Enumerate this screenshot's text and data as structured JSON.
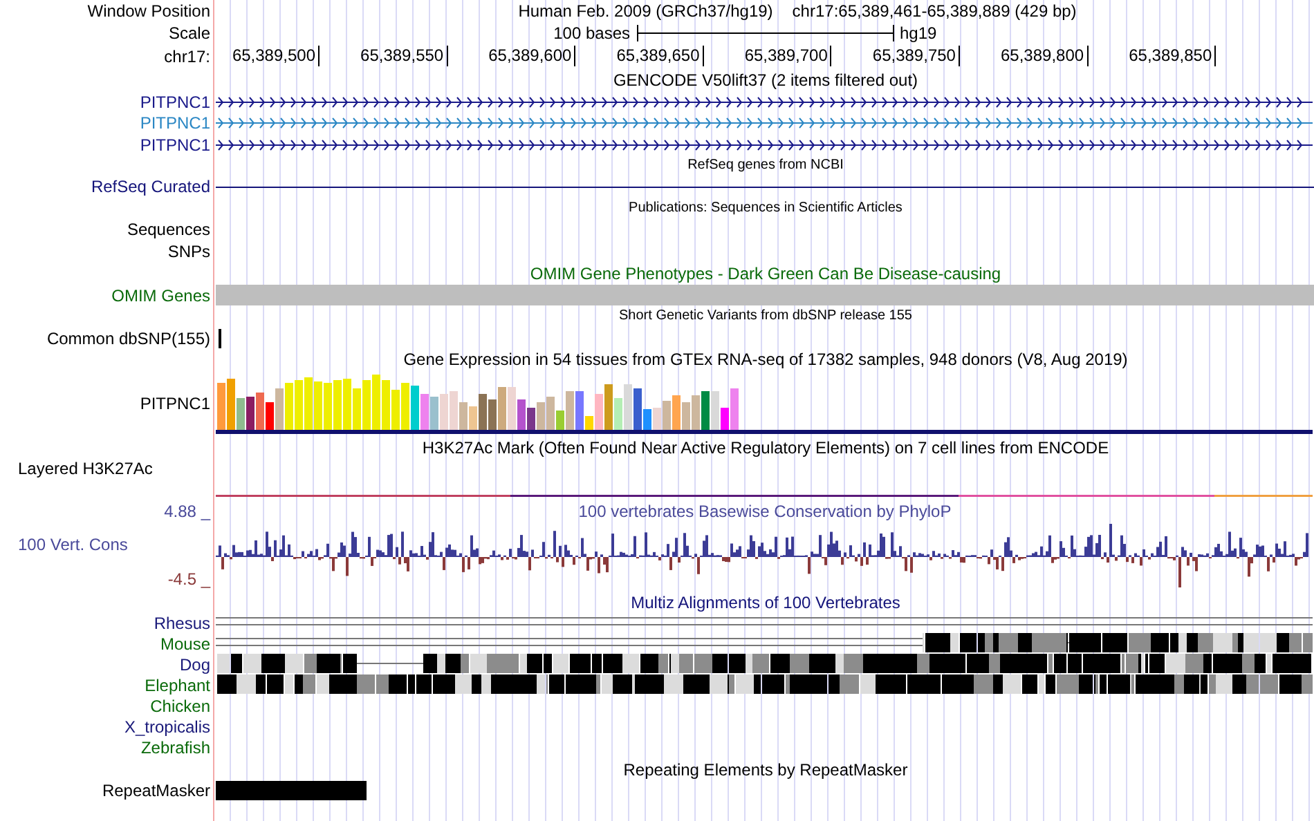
{
  "header": {
    "window_position_label": "Window Position",
    "assembly": "Human Feb. 2009 (GRCh37/hg19)",
    "position": "chr17:65,389,461-65,389,889 (429 bp)",
    "scale_label": "Scale",
    "scale_text": "100 bases",
    "scale_db": "hg19",
    "chrom_label": "chr17:",
    "ticks": [
      "65,389,500",
      "65,389,550",
      "65,389,600",
      "65,389,650",
      "65,389,700",
      "65,389,750",
      "65,389,800",
      "65,389,850"
    ]
  },
  "gencode": {
    "title": "GENCODE V50lift37 (2 items filtered out)",
    "transcripts": [
      {
        "label": "PITPNC1",
        "color": "#1a1a8a"
      },
      {
        "label": "PITPNC1",
        "color": "#2b87c4"
      },
      {
        "label": "PITPNC1",
        "color": "#1a1a8a"
      }
    ]
  },
  "refseq": {
    "title": "RefSeq genes from NCBI",
    "label": "RefSeq Curated"
  },
  "publications": {
    "title": "Publications: Sequences in Scientific Articles",
    "labels": [
      "Sequences",
      "SNPs"
    ]
  },
  "omim": {
    "title": "OMIM Gene Phenotypes - Dark Green Can Be Disease-causing",
    "label": "OMIM Genes"
  },
  "dbsnp": {
    "title": "Short Genetic Variants from dbSNP release 155",
    "label": "Common dbSNP(155)"
  },
  "gtex": {
    "title": "Gene Expression in 54 tissues from GTEx RNA-seq of 17382 samples, 948 donors (V8, Aug 2019)",
    "label": "PITPNC1"
  },
  "h3k27ac": {
    "title": "H3K27Ac Mark (Often Found Near Active Regulatory Elements) on 7 cell lines from ENCODE",
    "label": "Layered H3K27Ac"
  },
  "conservation": {
    "title": "100 vertebrates Basewise Conservation by PhyloP",
    "label": "100 Vert. Cons",
    "max_label": "4.88 _",
    "min_label": "-4.5 _"
  },
  "multiz": {
    "title": "Multiz Alignments of 100 Vertebrates",
    "species": [
      {
        "name": "Rhesus",
        "color": "#1a1a7a"
      },
      {
        "name": "Mouse",
        "color": "#0a6a0a"
      },
      {
        "name": "Dog",
        "color": "#1a1a7a"
      },
      {
        "name": "Elephant",
        "color": "#0a6a0a"
      },
      {
        "name": "Chicken",
        "color": "#0a6a0a"
      },
      {
        "name": "X_tropicalis",
        "color": "#1a1a7a"
      },
      {
        "name": "Zebrafish",
        "color": "#0a6a0a"
      }
    ]
  },
  "repeatmasker": {
    "title": "Repeating Elements by RepeatMasker",
    "label": "RepeatMasker"
  }
}
